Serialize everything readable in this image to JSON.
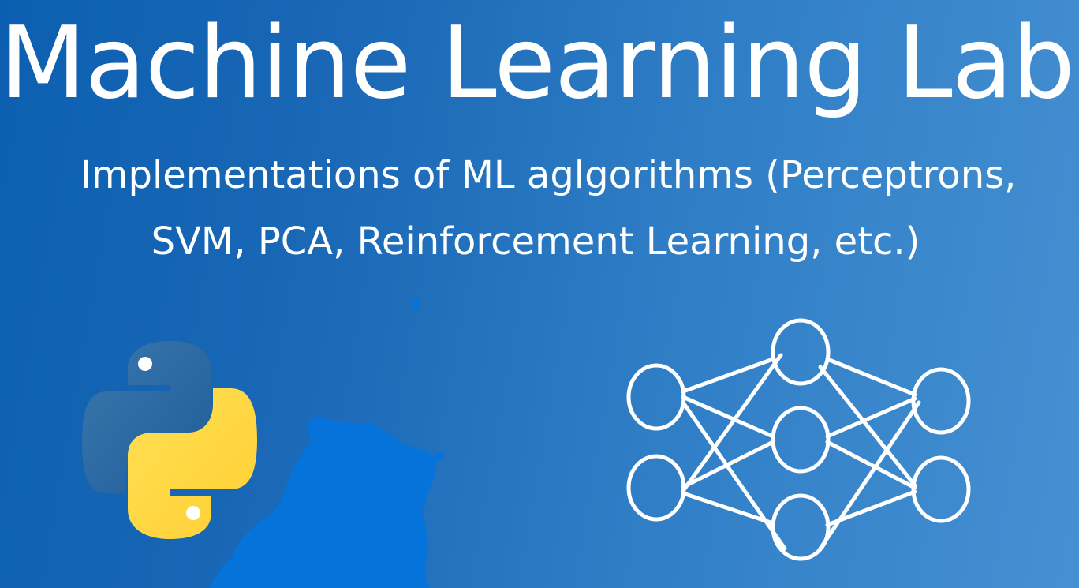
{
  "banner": {
    "title": "Machine Learning Labs",
    "subtitle_line_1": "Implementations of ML aglgorithms (Perceptrons,",
    "subtitle_line_2": "SVM, PCA, Reinforcement Learning, etc.)"
  },
  "icons": {
    "logo": "python-logo",
    "splash": "blue-paint-splash",
    "network": "neural-network-icon"
  },
  "colors": {
    "background_start": "#0c5fb0",
    "background_end": "#4690d2",
    "python_blue": "#2f69a6",
    "python_yellow": "#ffd640",
    "splash_blue": "#0573d9",
    "text": "#ffffff"
  }
}
